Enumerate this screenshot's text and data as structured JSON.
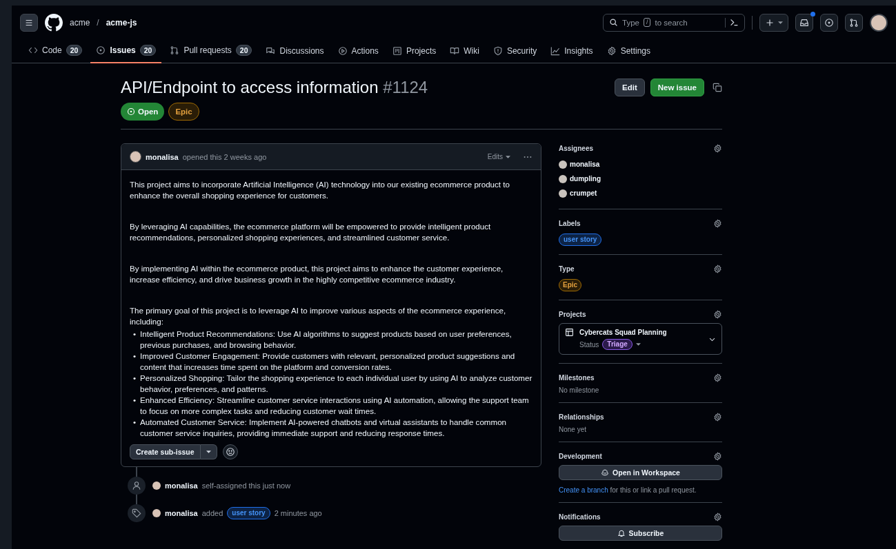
{
  "header": {
    "owner": "acme",
    "separator": "/",
    "repo": "acme-js",
    "search": {
      "before": "Type",
      "key": "/",
      "after": "to search"
    },
    "inbox_unread": true
  },
  "nav": [
    {
      "label": "Code",
      "count": "20",
      "selected": false
    },
    {
      "label": "Issues",
      "count": "20",
      "selected": true
    },
    {
      "label": "Pull requests",
      "count": "20",
      "selected": false
    },
    {
      "label": "Discussions",
      "selected": false
    },
    {
      "label": "Actions",
      "selected": false
    },
    {
      "label": "Projects",
      "selected": false
    },
    {
      "label": "Wiki",
      "selected": false
    },
    {
      "label": "Security",
      "selected": false
    },
    {
      "label": "Insights",
      "selected": false
    },
    {
      "label": "Settings",
      "selected": false
    }
  ],
  "issue": {
    "title": "API/Endpoint to access information",
    "number": "#1124",
    "state": "Open",
    "type": "Epic",
    "buttons": [
      "Edit",
      "New issue"
    ]
  },
  "comment": {
    "author": "monalisa",
    "action": "opened this 2 weeks ago",
    "edits": "Edits",
    "blocks": [
      {
        "kind": "p",
        "text": "This project aims to incorporate Artificial Intelligence (AI) technology into our existing ecommerce product to enhance the overall shopping experience for customers."
      },
      {
        "kind": "p",
        "text": "By leveraging AI capabilities, the ecommerce platform will be empowered to provide intelligent product recommendations, personalized shopping experiences, and streamlined customer service."
      },
      {
        "kind": "p",
        "text": "By implementing AI within the ecommerce product, this project aims to enhance the customer experience, increase efficiency, and drive business growth in the highly competitive ecommerce industry."
      },
      {
        "kind": "p",
        "text": "The primary goal of this project is to leverage AI to improve various aspects of the ecommerce experience, including:"
      },
      {
        "kind": "list",
        "marker": "•",
        "items": [
          "Intelligent Product Recommendations: Use AI algorithms to suggest products based on user preferences, previous purchases, and browsing behavior.",
          "Improved Customer Engagement: Provide customers with relevant, personalized product suggestions and content that increases time spent on the platform and conversion rates.",
          "Personalized Shopping: Tailor the shopping experience to each individual user by using AI to analyze customer behavior, preferences, and patterns.",
          "Enhanced Efficiency: Streamline customer service interactions using AI automation, allowing the support team to focus on more complex tasks and reducing customer wait times.",
          "Automated Customer Service: Implement AI-powered chatbots and virtual assistants to handle common customer service inquiries, providing immediate support and reducing response times."
        ]
      }
    ],
    "footer_button": "Create sub-issue"
  },
  "timeline": [
    {
      "kind": "assign",
      "author": "monalisa",
      "text": "self-assigned this just now"
    },
    {
      "kind": "label",
      "author": "monalisa",
      "before": "added",
      "label": "user story",
      "after": "2 minutes ago"
    }
  ],
  "sidebar": [
    {
      "kind": "people",
      "title": "Assignees",
      "people": [
        "monalisa",
        "dumpling",
        "crumpet"
      ]
    },
    {
      "kind": "label",
      "title": "Labels",
      "chip": "user story"
    },
    {
      "kind": "type",
      "title": "Type",
      "chip": "Epic"
    },
    {
      "kind": "project",
      "title": "Projects",
      "project": "Cybercats Squad Planning",
      "status_label": "Status",
      "status": "Triage"
    },
    {
      "kind": "text",
      "title": "Milestones",
      "text": "No milestone"
    },
    {
      "kind": "text",
      "title": "Relationships",
      "text": "None yet"
    },
    {
      "kind": "dev",
      "title": "Development",
      "button": "Open in Workspace",
      "link": "Create a branch",
      "rest": "for this or link a pull request."
    },
    {
      "kind": "notify",
      "title": "Notifications",
      "button": "Subscribe"
    }
  ]
}
